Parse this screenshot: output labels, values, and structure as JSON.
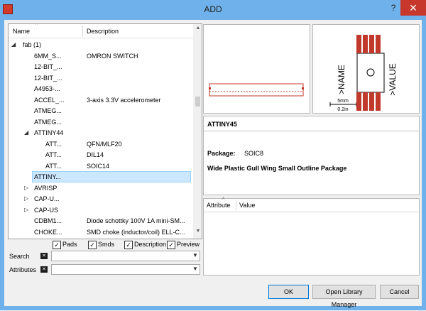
{
  "window": {
    "title": "ADD",
    "help_glyph": "?",
    "close_glyph": "✕"
  },
  "tree": {
    "columns": {
      "name": "Name",
      "description": "Description"
    },
    "rows": [
      {
        "name": "fab (1)",
        "description": "",
        "toggle": "◢",
        "level": 0
      },
      {
        "name": "6MM_S...",
        "description": "OMRON SWITCH",
        "toggle": "",
        "level": 1
      },
      {
        "name": "12-BIT_...",
        "description": "",
        "toggle": "",
        "level": 1
      },
      {
        "name": "12-BIT_...",
        "description": "",
        "toggle": "",
        "level": 1
      },
      {
        "name": "A4953-...",
        "description": "",
        "toggle": "",
        "level": 1
      },
      {
        "name": "ACCEL_...",
        "description": "3-axis 3.3V accelerometer",
        "toggle": "",
        "level": 1
      },
      {
        "name": "ATMEG...",
        "description": "",
        "toggle": "",
        "level": 1
      },
      {
        "name": "ATMEG...",
        "description": "",
        "toggle": "",
        "level": 1
      },
      {
        "name": "ATTINY44",
        "description": "",
        "toggle": "◢",
        "level": 1
      },
      {
        "name": "ATT...",
        "description": "QFN/MLF20",
        "toggle": "",
        "level": 2
      },
      {
        "name": "ATT...",
        "description": "DIL14",
        "toggle": "",
        "level": 2
      },
      {
        "name": "ATT...",
        "description": "SOIC14",
        "toggle": "",
        "level": 2
      },
      {
        "name": "ATTINY...",
        "description": "",
        "toggle": "",
        "level": 1,
        "selected": true
      },
      {
        "name": "AVRISP",
        "description": "",
        "toggle": "▷",
        "level": 1
      },
      {
        "name": "CAP-U...",
        "description": "",
        "toggle": "▷",
        "level": 1
      },
      {
        "name": "CAP-US",
        "description": "",
        "toggle": "▷",
        "level": 1
      },
      {
        "name": "CDBM1...",
        "description": "Diode schottky 100V 1A mini-SM...",
        "toggle": "",
        "level": 1
      },
      {
        "name": "CHOKE...",
        "description": "SMD choke (inductor/coil) ELL-C...",
        "toggle": "",
        "level": 1
      }
    ]
  },
  "filters": {
    "pads": {
      "label": "Pads",
      "checked": true
    },
    "smds": {
      "label": "Smds",
      "checked": true
    },
    "description": {
      "label": "Description",
      "checked": true
    },
    "preview": {
      "label": "Preview",
      "checked": true
    }
  },
  "search": {
    "label": "Search",
    "value": ""
  },
  "attributes": {
    "label": "Attributes",
    "value": ""
  },
  "preview": {
    "name_text": ">NAME",
    "value_text": ">VALUE",
    "scale_mm": "5mm",
    "scale_in": "0.2in"
  },
  "info": {
    "title": "ATTINY45",
    "package_label": "Package:",
    "package_value": "SOIC8",
    "package_description": "Wide Plastic Gull Wing Small Outline Package"
  },
  "attr_table": {
    "columns": [
      "Attribute",
      "Value"
    ]
  },
  "buttons": {
    "ok": "OK",
    "open_library_manager": "Open Library Manager",
    "cancel": "Cancel"
  },
  "colors": {
    "titlebar": "#6fb1ea",
    "close": "#c7372b",
    "selection": "#cce8ff",
    "pad": "#c0392b"
  }
}
